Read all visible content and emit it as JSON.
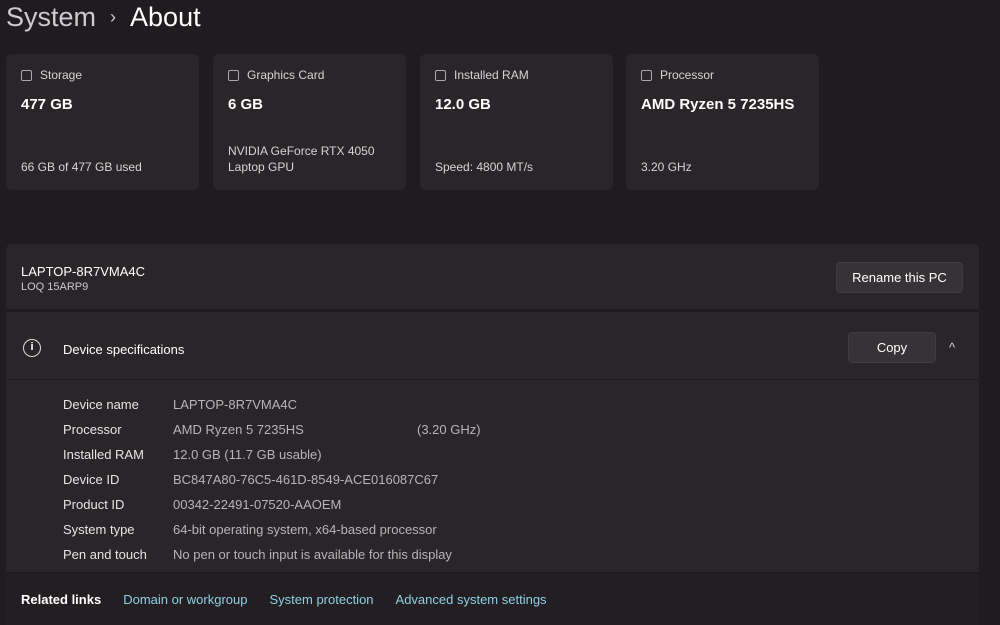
{
  "header": {
    "crumb": "System",
    "separator": "›",
    "title": "About"
  },
  "cards": [
    {
      "label": "Storage",
      "icon": "storage-icon",
      "value": "477 GB",
      "sub": "66 GB of 477 GB used"
    },
    {
      "label": "Graphics Card",
      "icon": "gpu-icon",
      "value": "6 GB",
      "sub": "NVIDIA GeForce RTX 4050 Laptop GPU"
    },
    {
      "label": "Installed RAM",
      "icon": "ram-icon",
      "value": "12.0 GB",
      "sub": "Speed: 4800 MT/s"
    },
    {
      "label": "Processor",
      "icon": "cpu-icon",
      "value": "AMD Ryzen 5 7235HS",
      "sub": "3.20 GHz"
    }
  ],
  "pc": {
    "name": "LAPTOP-8R7VMA4C",
    "model": "LOQ 15ARP9",
    "rename_label": "Rename this PC"
  },
  "specs": {
    "title": "Device specifications",
    "copy_label": "Copy",
    "chevron": "^",
    "rows": [
      {
        "k": "Device name",
        "v": "LAPTOP-8R7VMA4C"
      },
      {
        "k": "Processor",
        "v": "AMD Ryzen 5 7235HS",
        "x": "(3.20 GHz)"
      },
      {
        "k": "Installed RAM",
        "v": "12.0 GB (11.7 GB usable)"
      },
      {
        "k": "Device ID",
        "v": "BC847A80-76C5-461D-8549-ACE016087C67"
      },
      {
        "k": "Product ID",
        "v": "00342-22491-07520-AAOEM"
      },
      {
        "k": "System type",
        "v": "64-bit operating system, x64-based processor"
      },
      {
        "k": "Pen and touch",
        "v": "No pen or touch input is available for this display"
      }
    ]
  },
  "related": {
    "label": "Related links",
    "links": [
      "Domain or workgroup",
      "System protection",
      "Advanced system settings"
    ]
  }
}
